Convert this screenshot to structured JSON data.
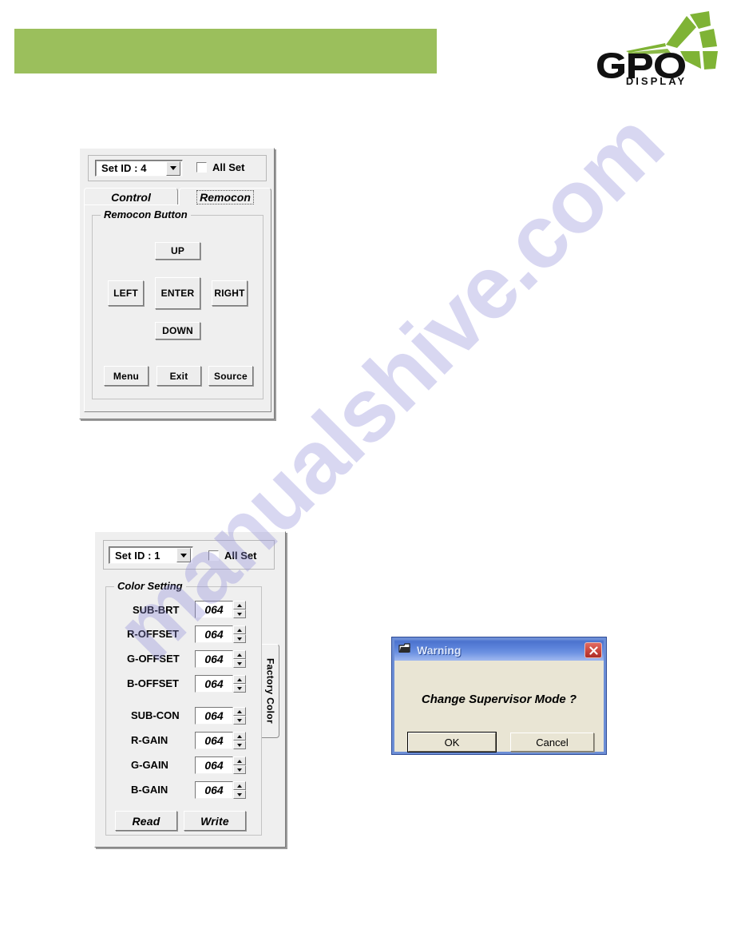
{
  "page": {
    "header_band_color": "#9BBF5C",
    "watermark_text": "manualshive.com"
  },
  "logo": {
    "brand": "GPO",
    "subtitle": "D I S P L A Y",
    "mark_color": "#7FB335"
  },
  "remocon_panel": {
    "set_id": {
      "label": "Set ID :  4",
      "value": "4"
    },
    "all_set": {
      "label": "All Set",
      "checked": false
    },
    "tabs": [
      {
        "label": "Control",
        "selected": false
      },
      {
        "label": "Remocon",
        "selected": true
      }
    ],
    "group_title": "Remocon Button",
    "dpad": {
      "up": "UP",
      "left": "LEFT",
      "enter": "ENTER",
      "right": "RIGHT",
      "down": "DOWN"
    },
    "actions": [
      {
        "label": "Menu"
      },
      {
        "label": "Exit"
      },
      {
        "label": "Source"
      }
    ]
  },
  "color_panel": {
    "set_id": {
      "label": "Set ID : 1",
      "value": "1"
    },
    "all_set": {
      "label": "All Set",
      "checked": false
    },
    "group_title": "Color Setting",
    "side_tab": "Factory Color",
    "fields_group_1": [
      {
        "label": "SUB-BRT",
        "value": "064"
      },
      {
        "label": "R-OFFSET",
        "value": "064"
      },
      {
        "label": "G-OFFSET",
        "value": "064"
      },
      {
        "label": "B-OFFSET",
        "value": "064"
      }
    ],
    "fields_group_2": [
      {
        "label": "SUB-CON",
        "value": "064"
      },
      {
        "label": "R-GAIN",
        "value": "064"
      },
      {
        "label": "G-GAIN",
        "value": "064"
      },
      {
        "label": "B-GAIN",
        "value": "064"
      }
    ],
    "buttons": {
      "read": "Read",
      "write": "Write"
    }
  },
  "warning_dialog": {
    "title": "Warning",
    "message": "Change Supervisor Mode ?",
    "ok_label": "OK",
    "cancel_label": "Cancel",
    "titlebar_color": "#4C73CE",
    "close_color": "#C9453C"
  }
}
